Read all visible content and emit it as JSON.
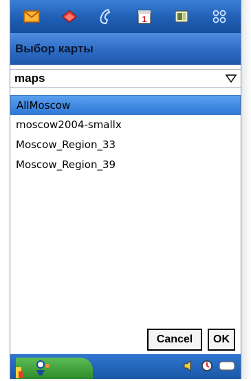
{
  "appbar": {
    "icons": [
      "mail-icon",
      "book-icon",
      "phone-icon",
      "calendar-icon",
      "contacts-icon",
      "apps-grid-icon"
    ],
    "calendar_day": "1"
  },
  "dialog": {
    "title": "Выбор карты",
    "source_value": "maps",
    "items": [
      "AllMoscow",
      "moscow2004-smallx",
      "Moscow_Region_33",
      "Moscow_Region_39"
    ],
    "selected_index": 0,
    "cancel_label": "Cancel",
    "ok_label": "OK"
  },
  "taskbar": {
    "start_icon": "start-icon",
    "tray_icons": [
      "volume-icon",
      "clock-icon",
      "battery-icon"
    ]
  },
  "colors": {
    "bar_blue": "#1f5fb4",
    "selection": "#3f8ae5"
  }
}
